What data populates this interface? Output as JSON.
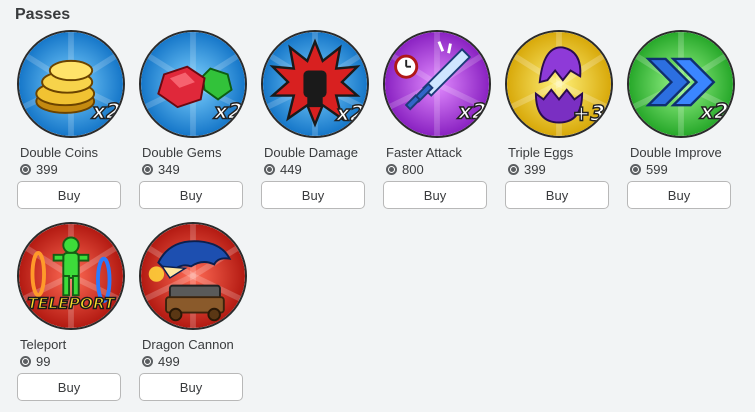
{
  "section": {
    "title": "Passes"
  },
  "passes": [
    {
      "name": "Double Coins",
      "price": "399",
      "buy_label": "Buy",
      "icon": "gold-coins-icon",
      "badge": "x2"
    },
    {
      "name": "Double Gems",
      "price": "349",
      "buy_label": "Buy",
      "icon": "gems-icon",
      "badge": "x2"
    },
    {
      "name": "Double Damage",
      "price": "449",
      "buy_label": "Buy",
      "icon": "fist-explosion-icon",
      "badge": "x2"
    },
    {
      "name": "Faster Attack",
      "price": "800",
      "buy_label": "Buy",
      "icon": "sword-clock-icon",
      "badge": "x2"
    },
    {
      "name": "Triple Eggs",
      "price": "399",
      "buy_label": "Buy",
      "icon": "purple-egg-icon",
      "badge": "+3"
    },
    {
      "name": "Double Improve",
      "price": "599",
      "buy_label": "Buy",
      "icon": "double-chevron-icon",
      "badge": "x2"
    },
    {
      "name": "Teleport",
      "price": "99",
      "buy_label": "Buy",
      "icon": "teleport-portal-icon",
      "badge": "TELEPORT"
    },
    {
      "name": "Dragon Cannon",
      "price": "499",
      "buy_label": "Buy",
      "icon": "dragon-cannon-icon",
      "badge": ""
    }
  ],
  "colors": {
    "blue_bg": "#2a8fd8",
    "red_bg": "#c4231c",
    "purple_bg": "#a43ad0",
    "yellow_bg": "#e6c21a",
    "green_bg": "#3cc23a"
  }
}
